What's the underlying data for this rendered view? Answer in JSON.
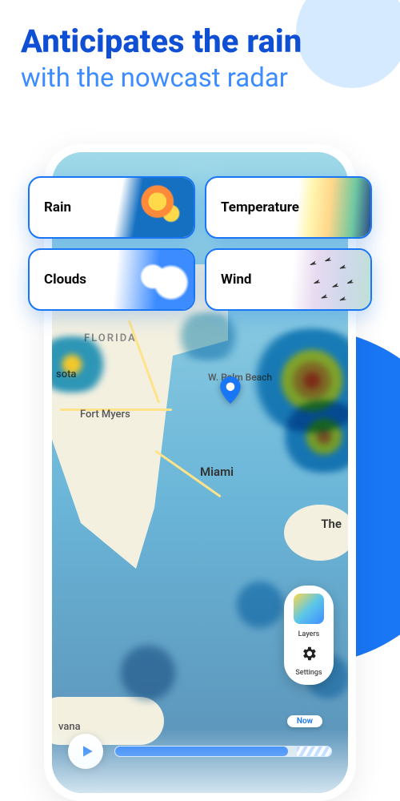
{
  "hero": {
    "title": "Anticipates the rain",
    "subtitle": "with the nowcast radar"
  },
  "layers": {
    "rain": "Rain",
    "temperature": "Temperature",
    "clouds": "Clouds",
    "wind": "Wind"
  },
  "map": {
    "state": "FLORIDA",
    "cities": {
      "sota": "sota",
      "fort_myers": "Fort Myers",
      "palm": "W. Palm Beach",
      "miami": "Miami",
      "vana": "vana",
      "the": "The"
    }
  },
  "controls": {
    "layers": "Layers",
    "settings": "Settings"
  },
  "playback": {
    "now": "Now"
  },
  "colors": {
    "primary": "#1976f5",
    "accent": "#3d8cff"
  }
}
